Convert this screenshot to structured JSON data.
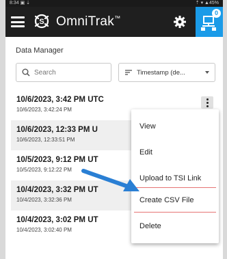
{
  "status_bar": {
    "left": "8:34 ▣ ⇣",
    "right": "⇡ ▾ ▲45%"
  },
  "app_bar": {
    "title": "OmniTrak",
    "trademark": "™",
    "sync_badge": "0"
  },
  "data_manager": {
    "title": "Data Manager",
    "search": {
      "placeholder": "Search"
    },
    "sort": {
      "label": "Timestamp (de..."
    }
  },
  "files": [
    {
      "title": "10/6/2023, 3:42 PM UTC",
      "subtitle": "10/6/2023, 3:42:24 PM"
    },
    {
      "title": "10/6/2023, 12:33 PM U",
      "subtitle": "10/6/2023, 12:33:51 PM"
    },
    {
      "title": "10/5/2023, 9:12 PM UT",
      "subtitle": "10/5/2023, 9:12:22 PM"
    },
    {
      "title": "10/4/2023, 3:32 PM UT",
      "subtitle": "10/4/2023, 3:32:36 PM"
    },
    {
      "title": "10/4/2023, 3:02 PM UT",
      "subtitle": "10/4/2023, 3:02:40 PM"
    }
  ],
  "context_menu": {
    "items": [
      "View",
      "Edit",
      "Upload to TSI Link",
      "Create CSV File",
      "Delete"
    ]
  },
  "colors": {
    "app_bar": "#1f1f1f",
    "accent": "#1a9be8",
    "arrow": "#2a7fd4",
    "divider": "#e57373"
  }
}
